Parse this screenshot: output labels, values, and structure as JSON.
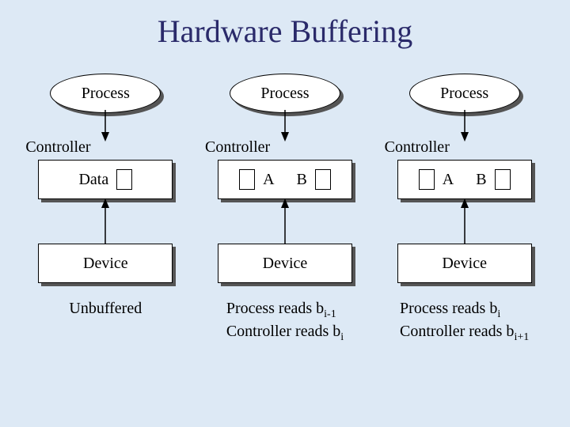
{
  "title": "Hardware Buffering",
  "columns": [
    {
      "process": "Process",
      "controller": "Controller",
      "box_type": "data",
      "data_label": "Data",
      "device": "Device",
      "caption_type": "plain",
      "caption_plain": "Unbuffered"
    },
    {
      "process": "Process",
      "controller": "Controller",
      "box_type": "ab",
      "label_a": "A",
      "label_b": "B",
      "device": "Device",
      "caption_type": "rich",
      "caption_l1_pre": "Process reads b",
      "caption_l1_sub": "i-1",
      "caption_l2_pre": "Controller reads b",
      "caption_l2_sub": "i"
    },
    {
      "process": "Process",
      "controller": "Controller",
      "box_type": "ab",
      "label_a": "A",
      "label_b": "B",
      "device": "Device",
      "caption_type": "rich",
      "caption_l1_pre": "Process reads b",
      "caption_l1_sub": "i",
      "caption_l2_pre": "Controller reads b",
      "caption_l2_sub": "i+1"
    }
  ]
}
